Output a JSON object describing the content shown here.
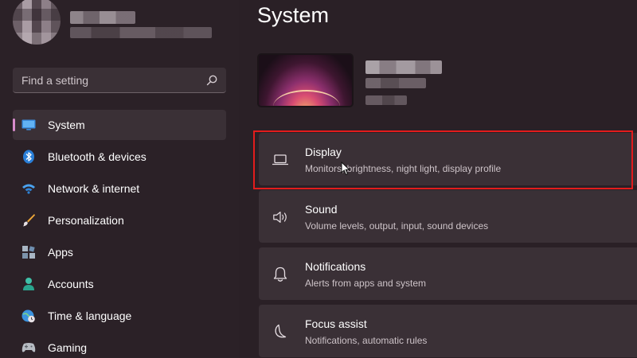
{
  "sidebar": {
    "search": {
      "placeholder": "Find a setting"
    },
    "items": [
      {
        "id": "system",
        "label": "System",
        "icon": "monitor-icon",
        "active": true
      },
      {
        "id": "bluetooth",
        "label": "Bluetooth & devices",
        "icon": "bluetooth-icon"
      },
      {
        "id": "network",
        "label": "Network & internet",
        "icon": "wifi-icon"
      },
      {
        "id": "personalization",
        "label": "Personalization",
        "icon": "paintbrush-icon"
      },
      {
        "id": "apps",
        "label": "Apps",
        "icon": "apps-icon"
      },
      {
        "id": "accounts",
        "label": "Accounts",
        "icon": "person-icon"
      },
      {
        "id": "time",
        "label": "Time & language",
        "icon": "globe-clock-icon"
      },
      {
        "id": "gaming",
        "label": "Gaming",
        "icon": "gamepad-icon"
      }
    ]
  },
  "main": {
    "title": "System",
    "cards": [
      {
        "id": "display",
        "title": "Display",
        "description": "Monitors, brightness, night light, display profile",
        "icon": "laptop-icon",
        "highlighted": true
      },
      {
        "id": "sound",
        "title": "Sound",
        "description": "Volume levels, output, input, sound devices",
        "icon": "speaker-icon"
      },
      {
        "id": "notifications",
        "title": "Notifications",
        "description": "Alerts from apps and system",
        "icon": "bell-icon"
      },
      {
        "id": "focus",
        "title": "Focus assist",
        "description": "Notifications, automatic rules",
        "icon": "moon-icon"
      }
    ]
  },
  "colors": {
    "background": "#2a2026",
    "card": "#3a3036",
    "accent": "#d88ccd",
    "highlight": "#e21c1c"
  }
}
